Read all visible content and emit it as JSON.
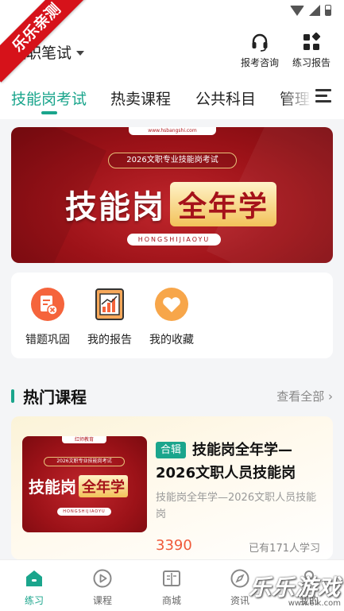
{
  "header": {
    "exam_selector": "文职笔试",
    "consult_label": "报考咨询",
    "report_label": "练习报告"
  },
  "watermark_ribbon": "乐乐亲测",
  "tabs": [
    {
      "label": "技能岗考试",
      "active": true
    },
    {
      "label": "热卖课程",
      "active": false
    },
    {
      "label": "公共科目",
      "active": false
    },
    {
      "label": "管理",
      "active": false
    }
  ],
  "banner": {
    "logo_text": "www.hsbangshi.com",
    "subtitle": "2026文职专业技能岗考试",
    "title_part1": "技能岗",
    "title_part2": "全年学",
    "pinyin": "HONGSHIJIAOYU"
  },
  "quick_access": [
    {
      "label": "错题巩固",
      "icon": "wrong-questions-icon"
    },
    {
      "label": "我的报告",
      "icon": "report-chart-icon"
    },
    {
      "label": "我的收藏",
      "icon": "heart-favorite-icon"
    }
  ],
  "hot_courses": {
    "title": "热门课程",
    "view_all": "查看全部 ›",
    "course": {
      "thumb_logo": "红师教育",
      "thumb_subtitle": "2026文职专业技能岗考试",
      "thumb_title_part1": "技能岗",
      "thumb_title_part2": "全年学",
      "thumb_pinyin": "HONGSHIJIAOYU",
      "tag": "合辑",
      "title": "技能岗全年学—2026文职人员技能岗",
      "description": "技能岗全年学—2026文职人员技能岗",
      "price": "3390",
      "learners": "已有171人学习"
    }
  },
  "bottom_nav": [
    {
      "label": "练习",
      "icon": "home-practice-icon",
      "active": true
    },
    {
      "label": "课程",
      "icon": "play-circle-icon",
      "active": false
    },
    {
      "label": "商城",
      "icon": "book-store-icon",
      "active": false
    },
    {
      "label": "资讯",
      "icon": "compass-news-icon",
      "active": false
    },
    {
      "label": "我的",
      "icon": "user-profile-icon",
      "active": false
    }
  ],
  "site_watermark": {
    "main": "乐乐游戏",
    "url": "www.6lk.com"
  },
  "colors": {
    "accent": "#1aa58c",
    "banner_red": "#9c1218",
    "price": "#f05a3a",
    "ribbon": "#d6121a"
  }
}
